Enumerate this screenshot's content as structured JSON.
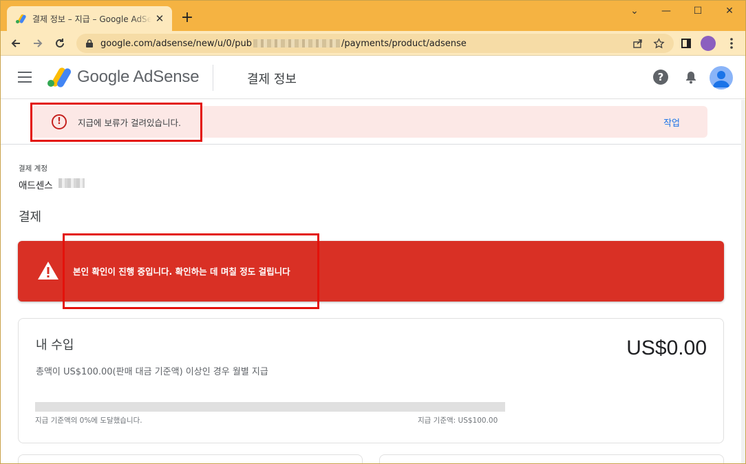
{
  "browser": {
    "tab_title": "결제 정보 – 지급 – Google AdSense",
    "tab_close": "✕",
    "new_tab": "+",
    "url_prefix": "google.com/adsense/new/u/0/pub",
    "url_suffix": "/payments/product/adsense",
    "window_controls": {
      "dropdown": "⌄",
      "minimize": "—",
      "maximize": "☐",
      "close": "✕"
    }
  },
  "appbar": {
    "brand": "Google AdSense",
    "page_title": "결제 정보",
    "help_glyph": "?"
  },
  "hold_banner": {
    "message": "지급에 보류가 걸려있습니다.",
    "action": "작업",
    "icon_glyph": "!"
  },
  "account": {
    "label": "결제 계정",
    "name": "애드센스"
  },
  "payments": {
    "section_title": "결제",
    "verification_message": "본인 확인이 진행 중입니다. 확인하는 데 며칠 정도 걸립니다"
  },
  "earnings": {
    "title": "내 수입",
    "amount": "US$0.00",
    "threshold_note": "총액이 US$100.00(판매 대금 기준액) 이상인 경우 월별 지급",
    "progress_fraction": 0,
    "progress_left": "지급 기준액의 0%에 도달했습니다.",
    "progress_right": "지급 기준액: US$100.00"
  },
  "colors": {
    "tabstrip": "#f5b342",
    "danger": "#d93025",
    "hold_bg": "#fce8e6",
    "link": "#1a73e8",
    "annotation_box": "#e3120b"
  }
}
